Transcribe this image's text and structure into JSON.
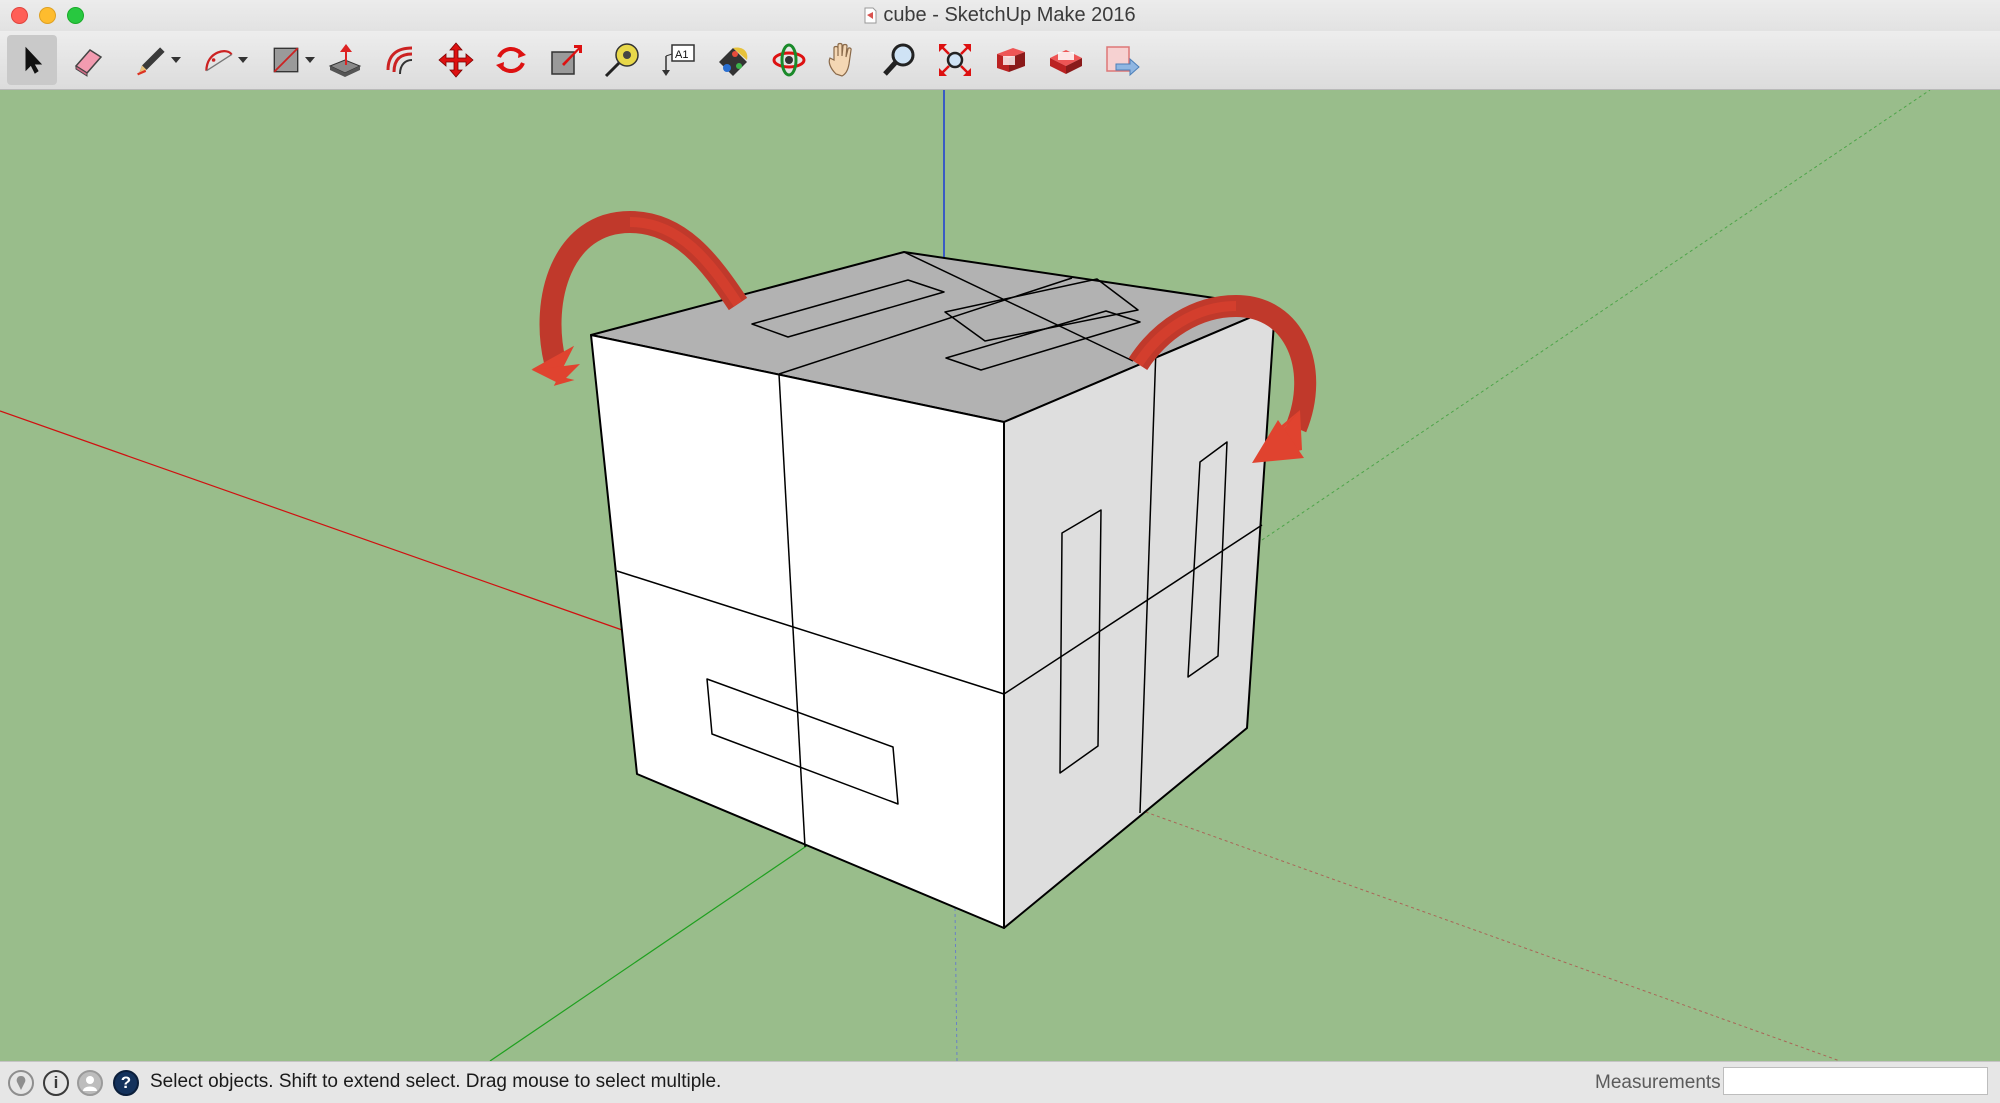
{
  "window": {
    "title": "cube - SketchUp Make 2016"
  },
  "toolbar": {
    "tools": [
      {
        "name": "Select",
        "icon": "arrow-cursor-icon"
      },
      {
        "name": "Eraser",
        "icon": "eraser-icon"
      },
      {
        "name": "Line",
        "icon": "pencil-icon"
      },
      {
        "name": "Arc",
        "icon": "arc-icon"
      },
      {
        "name": "Rectangle",
        "icon": "rectangle-icon"
      },
      {
        "name": "Push/Pull",
        "icon": "push-pull-icon"
      },
      {
        "name": "Offset",
        "icon": "offset-icon"
      },
      {
        "name": "Move",
        "icon": "move-icon"
      },
      {
        "name": "Rotate",
        "icon": "rotate-icon"
      },
      {
        "name": "Scale",
        "icon": "scale-icon"
      },
      {
        "name": "Tape Measure",
        "icon": "tape-measure-icon"
      },
      {
        "name": "Text",
        "icon": "text-icon",
        "glyph": "A1"
      },
      {
        "name": "Paint Bucket",
        "icon": "paint-bucket-icon"
      },
      {
        "name": "Orbit",
        "icon": "orbit-icon"
      },
      {
        "name": "Pan",
        "icon": "pan-hand-icon"
      },
      {
        "name": "Zoom",
        "icon": "zoom-icon"
      },
      {
        "name": "Zoom Extents",
        "icon": "zoom-extents-icon"
      },
      {
        "name": "3D Warehouse",
        "icon": "warehouse-icon"
      },
      {
        "name": "Extension Warehouse",
        "icon": "extension-warehouse-icon"
      },
      {
        "name": "Share Model",
        "icon": "share-model-icon"
      }
    ],
    "active_tool": "Select"
  },
  "viewport": {
    "background_color": "#99bd8b",
    "model": "cube",
    "annotation_color": "#e0432f"
  },
  "statusbar": {
    "message": "Select objects. Shift to extend select. Drag mouse to select multiple.",
    "measurements_label": "Measurements",
    "measurements_value": "",
    "help_glyph": "?",
    "info_glyph": "i"
  }
}
